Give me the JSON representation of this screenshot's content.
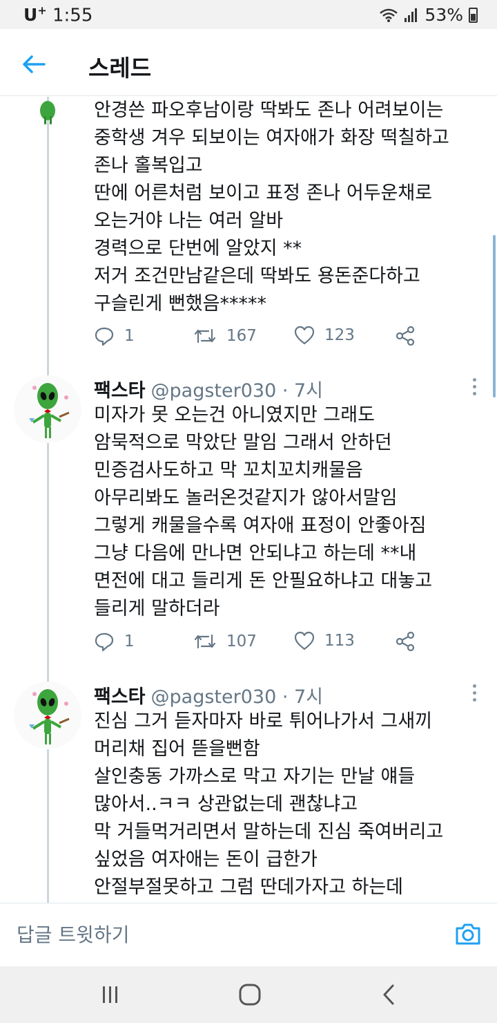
{
  "status_bar": {
    "carrier": "U",
    "carrier_suffix": "+",
    "time": "1:55",
    "battery": "53%"
  },
  "header": {
    "title": "스레드"
  },
  "tweets": [
    {
      "lines": [
        "안경쓴 파오후남이랑 딱봐도 존나 어려보이는",
        "중학생 겨우 되보이는 여자애가 화장 떡칠하고",
        "존나 홀복입고",
        "딴에 어른처럼 보이고 표정 존나 어두운채로",
        "오는거야 나는 여러 알바",
        "경력으로 단번에 알았지 **",
        "저거 조건만남같은데 딱봐도 용돈준다하고",
        "구슬린게 뻔했음*****"
      ],
      "replies": "1",
      "retweets": "167",
      "likes": "123"
    },
    {
      "name": "팩스타",
      "handle": "@pagster030 · 7시",
      "lines": [
        "미자가 못 오는건 아니였지만 그래도",
        "암묵적으로 막았단 말임 그래서 안하던",
        "민증검사도하고 막 꼬치꼬치캐물음",
        "아무리봐도 놀러온것같지가 않아서말임",
        "그렇게 캐물을수록 여자애 표정이 안좋아짐",
        "그냥 다음에 만나면 안되냐고 하는데 **내",
        "면전에 대고 들리게 돈 안필요하냐고 대놓고",
        "들리게 말하더라"
      ],
      "replies": "1",
      "retweets": "107",
      "likes": "113"
    },
    {
      "name": "팩스타",
      "handle": "@pagster030 · 7시",
      "lines": [
        "진심 그거 듣자마자 바로 튀어나가서 그새끼",
        "머리채 집어 뜯을뻔함",
        "살인충동 가까스로 막고 자기는 만날 얘들",
        "많아서..ㅋㅋ 상관없는데 괜찮냐고",
        "막 거들먹거리면서 말하는데 진심 죽여버리고",
        "싶었음 여자애는 돈이 급한가",
        "안절부절못하고 그럼 딴데가자고 하는데"
      ]
    }
  ],
  "reply_bar": {
    "placeholder": "답글 트윗하기"
  },
  "colors": {
    "accent": "#1da1f2",
    "text": "#14171a",
    "muted": "#657786",
    "divider": "#e1e8ed",
    "thread_line": "#ccd6dd"
  },
  "icons": [
    "back-arrow-icon",
    "reply-icon",
    "retweet-icon",
    "like-icon",
    "share-icon",
    "more-icon",
    "camera-icon",
    "recents-icon",
    "home-icon",
    "back-icon",
    "wifi-icon",
    "signal-icon",
    "battery-icon"
  ]
}
